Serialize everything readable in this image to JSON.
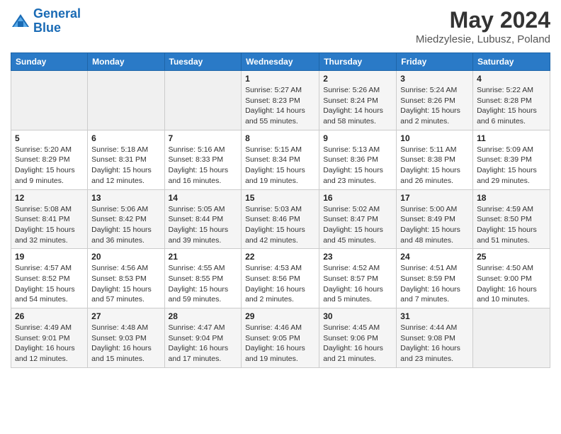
{
  "header": {
    "logo_line1": "General",
    "logo_line2": "Blue",
    "main_title": "May 2024",
    "subtitle": "Miedzylesie, Lubusz, Poland"
  },
  "days_of_week": [
    "Sunday",
    "Monday",
    "Tuesday",
    "Wednesday",
    "Thursday",
    "Friday",
    "Saturday"
  ],
  "weeks": [
    [
      {
        "day": "",
        "info": ""
      },
      {
        "day": "",
        "info": ""
      },
      {
        "day": "",
        "info": ""
      },
      {
        "day": "1",
        "info": "Sunrise: 5:27 AM\nSunset: 8:23 PM\nDaylight: 14 hours and 55 minutes."
      },
      {
        "day": "2",
        "info": "Sunrise: 5:26 AM\nSunset: 8:24 PM\nDaylight: 14 hours and 58 minutes."
      },
      {
        "day": "3",
        "info": "Sunrise: 5:24 AM\nSunset: 8:26 PM\nDaylight: 15 hours and 2 minutes."
      },
      {
        "day": "4",
        "info": "Sunrise: 5:22 AM\nSunset: 8:28 PM\nDaylight: 15 hours and 6 minutes."
      }
    ],
    [
      {
        "day": "5",
        "info": "Sunrise: 5:20 AM\nSunset: 8:29 PM\nDaylight: 15 hours and 9 minutes."
      },
      {
        "day": "6",
        "info": "Sunrise: 5:18 AM\nSunset: 8:31 PM\nDaylight: 15 hours and 12 minutes."
      },
      {
        "day": "7",
        "info": "Sunrise: 5:16 AM\nSunset: 8:33 PM\nDaylight: 15 hours and 16 minutes."
      },
      {
        "day": "8",
        "info": "Sunrise: 5:15 AM\nSunset: 8:34 PM\nDaylight: 15 hours and 19 minutes."
      },
      {
        "day": "9",
        "info": "Sunrise: 5:13 AM\nSunset: 8:36 PM\nDaylight: 15 hours and 23 minutes."
      },
      {
        "day": "10",
        "info": "Sunrise: 5:11 AM\nSunset: 8:38 PM\nDaylight: 15 hours and 26 minutes."
      },
      {
        "day": "11",
        "info": "Sunrise: 5:09 AM\nSunset: 8:39 PM\nDaylight: 15 hours and 29 minutes."
      }
    ],
    [
      {
        "day": "12",
        "info": "Sunrise: 5:08 AM\nSunset: 8:41 PM\nDaylight: 15 hours and 32 minutes."
      },
      {
        "day": "13",
        "info": "Sunrise: 5:06 AM\nSunset: 8:42 PM\nDaylight: 15 hours and 36 minutes."
      },
      {
        "day": "14",
        "info": "Sunrise: 5:05 AM\nSunset: 8:44 PM\nDaylight: 15 hours and 39 minutes."
      },
      {
        "day": "15",
        "info": "Sunrise: 5:03 AM\nSunset: 8:46 PM\nDaylight: 15 hours and 42 minutes."
      },
      {
        "day": "16",
        "info": "Sunrise: 5:02 AM\nSunset: 8:47 PM\nDaylight: 15 hours and 45 minutes."
      },
      {
        "day": "17",
        "info": "Sunrise: 5:00 AM\nSunset: 8:49 PM\nDaylight: 15 hours and 48 minutes."
      },
      {
        "day": "18",
        "info": "Sunrise: 4:59 AM\nSunset: 8:50 PM\nDaylight: 15 hours and 51 minutes."
      }
    ],
    [
      {
        "day": "19",
        "info": "Sunrise: 4:57 AM\nSunset: 8:52 PM\nDaylight: 15 hours and 54 minutes."
      },
      {
        "day": "20",
        "info": "Sunrise: 4:56 AM\nSunset: 8:53 PM\nDaylight: 15 hours and 57 minutes."
      },
      {
        "day": "21",
        "info": "Sunrise: 4:55 AM\nSunset: 8:55 PM\nDaylight: 15 hours and 59 minutes."
      },
      {
        "day": "22",
        "info": "Sunrise: 4:53 AM\nSunset: 8:56 PM\nDaylight: 16 hours and 2 minutes."
      },
      {
        "day": "23",
        "info": "Sunrise: 4:52 AM\nSunset: 8:57 PM\nDaylight: 16 hours and 5 minutes."
      },
      {
        "day": "24",
        "info": "Sunrise: 4:51 AM\nSunset: 8:59 PM\nDaylight: 16 hours and 7 minutes."
      },
      {
        "day": "25",
        "info": "Sunrise: 4:50 AM\nSunset: 9:00 PM\nDaylight: 16 hours and 10 minutes."
      }
    ],
    [
      {
        "day": "26",
        "info": "Sunrise: 4:49 AM\nSunset: 9:01 PM\nDaylight: 16 hours and 12 minutes."
      },
      {
        "day": "27",
        "info": "Sunrise: 4:48 AM\nSunset: 9:03 PM\nDaylight: 16 hours and 15 minutes."
      },
      {
        "day": "28",
        "info": "Sunrise: 4:47 AM\nSunset: 9:04 PM\nDaylight: 16 hours and 17 minutes."
      },
      {
        "day": "29",
        "info": "Sunrise: 4:46 AM\nSunset: 9:05 PM\nDaylight: 16 hours and 19 minutes."
      },
      {
        "day": "30",
        "info": "Sunrise: 4:45 AM\nSunset: 9:06 PM\nDaylight: 16 hours and 21 minutes."
      },
      {
        "day": "31",
        "info": "Sunrise: 4:44 AM\nSunset: 9:08 PM\nDaylight: 16 hours and 23 minutes."
      },
      {
        "day": "",
        "info": ""
      }
    ]
  ]
}
